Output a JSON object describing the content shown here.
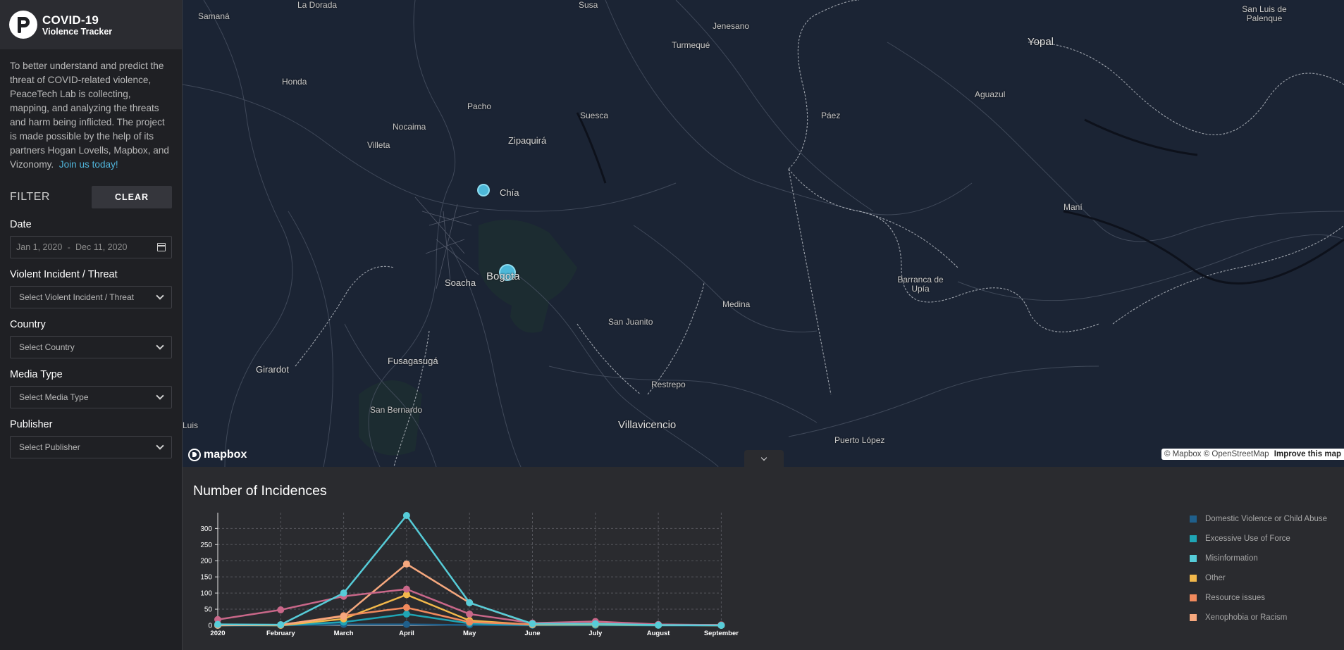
{
  "brand": {
    "title": "COVID-19",
    "subtitle": "Violence Tracker"
  },
  "about": {
    "text": "To better understand and predict the threat of COVID-related violence, PeaceTech Lab is collecting, mapping, and analyzing the threats and harm being inflicted. The project is made possible by the help of its partners Hogan Lovells, Mapbox, and Vizonomy.",
    "link": "Join us today!"
  },
  "filter": {
    "title": "FILTER",
    "clear_label": "CLEAR",
    "date": {
      "label": "Date",
      "start": "Jan 1, 2020",
      "sep": "-",
      "end": "Dec 11, 2020"
    },
    "incident": {
      "label": "Violent Incident / Threat",
      "placeholder": "Select Violent Incident / Threat"
    },
    "country": {
      "label": "Country",
      "placeholder": "Select Country"
    },
    "media": {
      "label": "Media Type",
      "placeholder": "Select Media Type"
    },
    "publisher": {
      "label": "Publisher",
      "placeholder": "Select Publisher"
    }
  },
  "map": {
    "places": [
      "Samaná",
      "La Dorada",
      "Susa",
      "Jenesano",
      "Turmequé",
      "San Luis de Palenque",
      "Yopal",
      "Honda",
      "Pacho",
      "Suesca",
      "Aguazul",
      "Nocaima",
      "Zipaquirá",
      "Páez",
      "Villeta",
      "Chía",
      "Maní",
      "Soacha",
      "Bogota",
      "Barranca de Upía",
      "Medina",
      "San Juanito",
      "Girardot",
      "Fusagasugá",
      "Restrepo",
      "San Bernardo",
      "Villavicencio",
      "Luis",
      "Puerto López"
    ],
    "attribution": "© Mapbox © OpenStreetMap",
    "improve": "Improve this map",
    "logo": "mapbox"
  },
  "panel": {
    "title": "Number of Incidences"
  },
  "colors": {
    "domestic": "#1f5f8b",
    "force": "#1fa5b5",
    "misinfo": "#56ccd8",
    "other": "#f2b84b",
    "resource": "#f08a5d",
    "xeno": "#f6a87e",
    "pink": "#c96789"
  },
  "chart_data": {
    "type": "line",
    "title": "Number of Incidences",
    "categories": [
      "2020",
      "February",
      "March",
      "April",
      "May",
      "June",
      "July",
      "August",
      "September"
    ],
    "yticks": [
      0,
      50,
      100,
      150,
      200,
      250,
      300
    ],
    "ylim": [
      0,
      340
    ],
    "grid": true,
    "legend_position": "right",
    "series": [
      {
        "name": "Domestic Violence or Child Abuse",
        "values": [
          0,
          0,
          3,
          3,
          1,
          0,
          0,
          0,
          0
        ]
      },
      {
        "name": "Excessive Use of Force",
        "values": [
          0,
          0,
          10,
          35,
          6,
          1,
          1,
          0,
          0
        ]
      },
      {
        "name": "Misinformation",
        "values": [
          3,
          2,
          100,
          340,
          70,
          5,
          5,
          1,
          0
        ]
      },
      {
        "name": "Other",
        "values": [
          1,
          0,
          20,
          95,
          15,
          2,
          3,
          1,
          0
        ]
      },
      {
        "name": "Resource issues",
        "values": [
          2,
          1,
          30,
          55,
          10,
          3,
          6,
          1,
          1
        ]
      },
      {
        "name": "Xenophobia or Racism",
        "values": [
          0,
          2,
          28,
          190,
          70,
          4,
          5,
          2,
          1
        ]
      },
      {
        "values": [
          18,
          48,
          90,
          112,
          35,
          7,
          12,
          3,
          1
        ]
      }
    ]
  }
}
